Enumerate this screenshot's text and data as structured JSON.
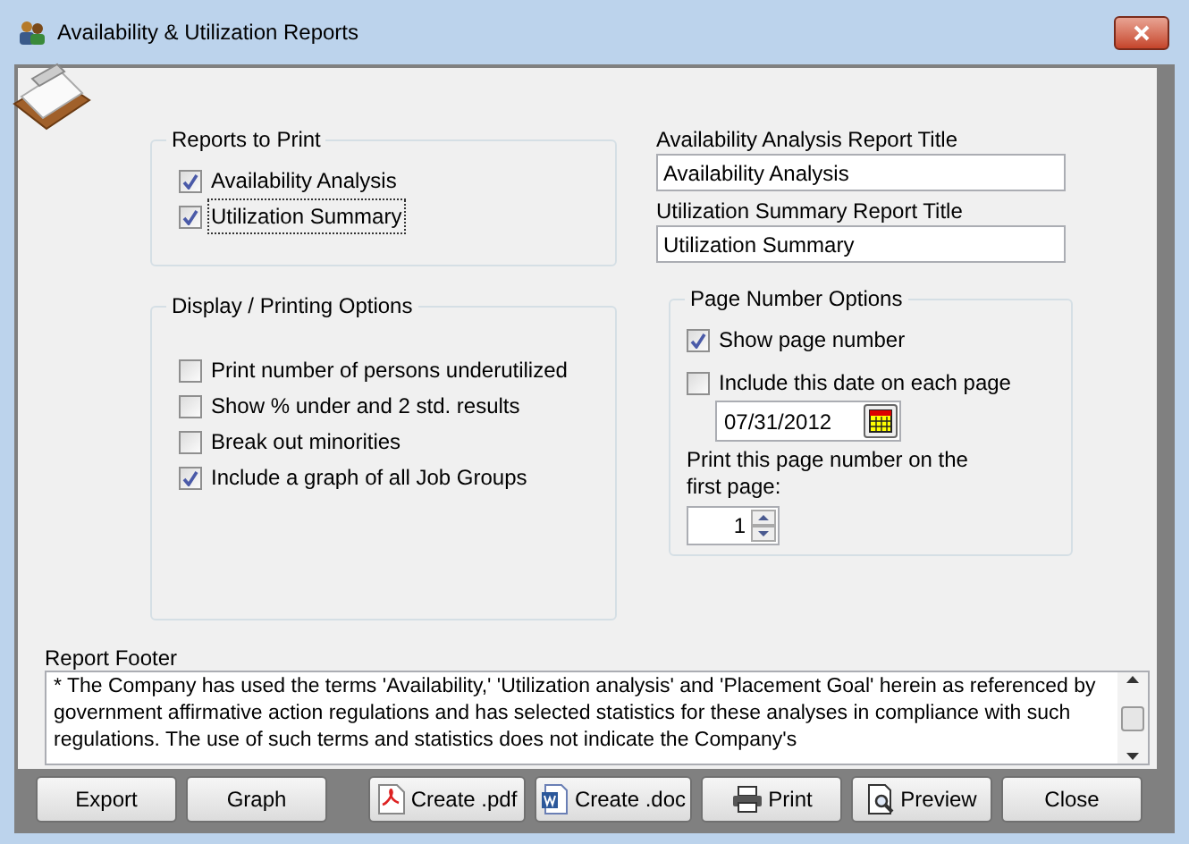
{
  "window": {
    "title": "Availability & Utilization Reports"
  },
  "reports_to_print": {
    "title": "Reports to Print",
    "items": [
      {
        "label": "Availability Analysis",
        "checked": true,
        "focused": false
      },
      {
        "label": "Utilization Summary",
        "checked": true,
        "focused": true
      }
    ]
  },
  "title_fields": [
    {
      "label": "Availability Analysis Report Title",
      "value": "Availability Analysis"
    },
    {
      "label": "Utilization Summary Report Title",
      "value": "Utilization Summary"
    }
  ],
  "display_options": {
    "title": "Display / Printing Options",
    "items": [
      {
        "label": "Print number of persons underutilized",
        "checked": false
      },
      {
        "label": "Show % under and 2 std. results",
        "checked": false
      },
      {
        "label": "Break out minorities",
        "checked": false
      },
      {
        "label": "Include a graph of all Job Groups",
        "checked": true
      }
    ]
  },
  "page_number_options": {
    "title": "Page Number Options",
    "show_page_number": {
      "label": "Show page number",
      "checked": true
    },
    "include_date": {
      "label": "Include this date on each page",
      "checked": false
    },
    "date": "07/31/2012",
    "first_page_label": "Print this page number on the first page:",
    "first_page_value": "1"
  },
  "report_footer": {
    "label": "Report Footer",
    "text": "* The Company has used the terms 'Availability,' 'Utilization analysis' and 'Placement Goal' herein as referenced by government affirmative action regulations and has selected statistics for these analyses in compliance with such regulations. The use of such terms and statistics does not indicate the Company's"
  },
  "buttons": [
    {
      "label": "Export",
      "kind": "plain"
    },
    {
      "label": "Graph",
      "kind": "plain"
    },
    {
      "label": "Create .pdf",
      "kind": "pdf"
    },
    {
      "label": "Create .doc",
      "kind": "doc"
    },
    {
      "label": "Print",
      "kind": "print"
    },
    {
      "label": "Preview",
      "kind": "preview"
    },
    {
      "label": "Close",
      "kind": "plain"
    }
  ]
}
